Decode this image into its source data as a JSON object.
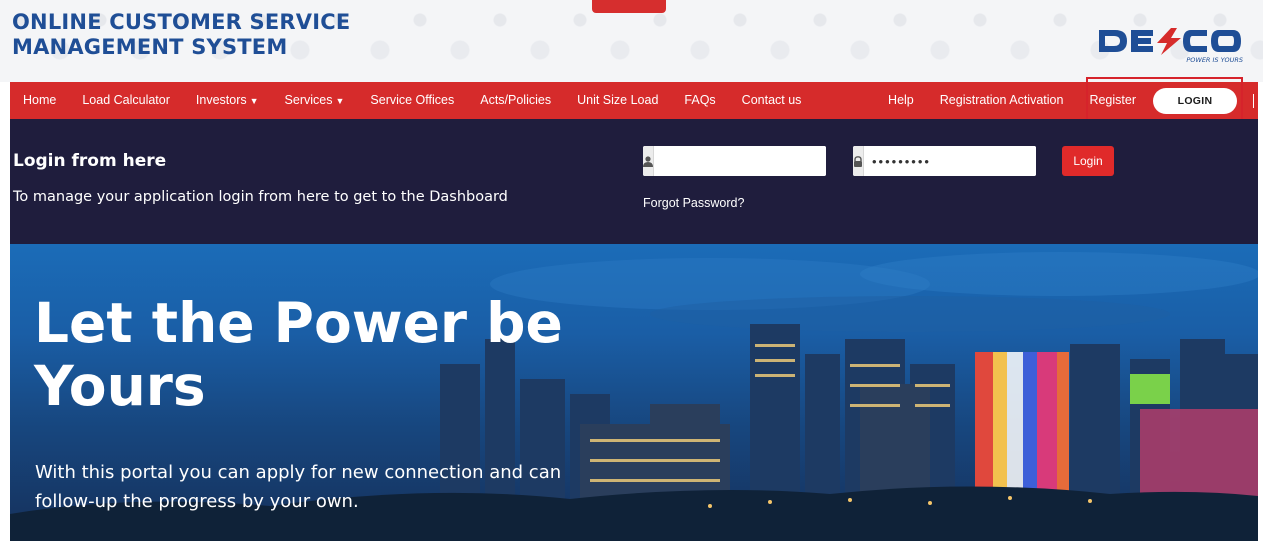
{
  "header": {
    "title": "ONLINE CUSTOMER SERVICE MANAGEMENT SYSTEM",
    "logo": {
      "text": "DESCO",
      "tagline": "POWER IS YOURS",
      "icon": "lightning-bolt-icon"
    }
  },
  "nav": {
    "items": [
      {
        "label": "Home"
      },
      {
        "label": "Load Calculator"
      },
      {
        "label": "Investors",
        "dropdown": true
      },
      {
        "label": "Services",
        "dropdown": true
      },
      {
        "label": "Service Offices"
      },
      {
        "label": "Acts/Policies"
      },
      {
        "label": "Unit Size Load"
      },
      {
        "label": "FAQs"
      },
      {
        "label": "Contact us"
      }
    ],
    "right_items": [
      {
        "label": "Help"
      },
      {
        "label": "Registration Activation"
      },
      {
        "label": "Register"
      }
    ],
    "login_label": "LOGIN"
  },
  "login": {
    "heading": "Login from here",
    "subtext": "To manage your application login from here to get to the Dashboard",
    "username": {
      "icon": "user-icon",
      "value": ""
    },
    "password": {
      "icon": "lock-icon",
      "value": "•••••••••"
    },
    "button_label": "Login",
    "forgot_label": "Forgot Password?"
  },
  "hero": {
    "title": "Let the Power be Yours",
    "text": "With this portal you can apply for new connection and can follow-up the progress by your own."
  },
  "colors": {
    "brand_blue": "#1f4e96",
    "nav_red": "#d62b2b",
    "login_band": "#1f1d3d",
    "highlight": "#d6232b"
  }
}
